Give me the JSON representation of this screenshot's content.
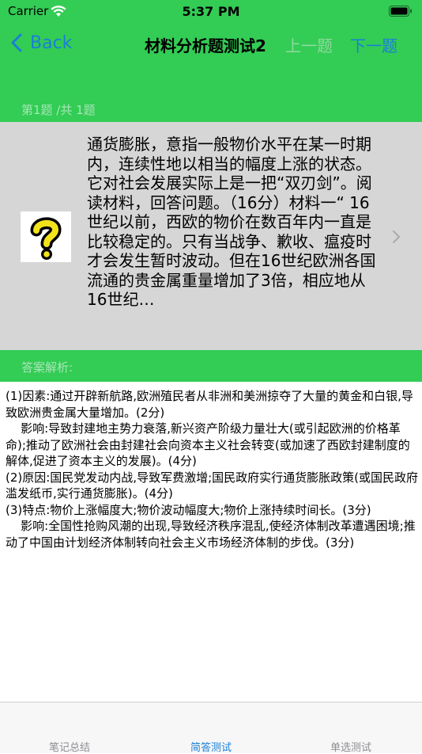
{
  "status": {
    "carrier": "Carrier",
    "time": "5:37 PM"
  },
  "nav": {
    "back_label": "Back",
    "title": "材料分析题测试2",
    "prev_label": "上一题",
    "next_label": "下一题"
  },
  "question_section": {
    "header": "第1题 /共 1题"
  },
  "question": {
    "text": "通货膨胀，意指一般物价水平在某一时期内，连续性地以相当的幅度上涨的状态。它对社会发展实际上是一把“双刃剑”。阅读材料，回答问题。（16分）材料一“ 16世纪以前，西欧的物价在数百年内一直是比较稳定的。只有当战争、歉收、瘟疫时才会发生暂时波动。但在16世纪欧洲各国流通的贵金属重量增加了3倍，相应地从16世纪…"
  },
  "answer_section": {
    "header": "答案解析:"
  },
  "answer": {
    "text": "(1)因素:通过开辟新航路,欧洲殖民者从非洲和美洲掠夺了大量的黄金和白银,导致欧洲贵金属大量增加。(2分)\n    影响:导致封建地主势力衰落,新兴资产阶级力量壮大(或引起欧洲的价格革命);推动了欧洲社会由封建社会向资本主义社会转变(或加速了西欧封建制度的解体,促进了资本主义的发展)。(4分)\n(2)原因:国民党发动内战,导致军费激增;国民政府实行通货膨胀政策(或国民政府滥发纸币,实行通货膨胀)。(4分)\n(3)特点:物价上涨幅度大;物价波动幅度大;物价上涨持续时间长。(3分)\n    影响:全国性抢购风潮的出现,导致经济秩序混乱,使经济体制改革遭遇困境;推动了中国由计划经济体制转向社会主义市场经济体制的步伐。(3分)"
  },
  "tabs": [
    {
      "label": "笔记总结"
    },
    {
      "label": "简答测试"
    },
    {
      "label": "单选测试"
    }
  ],
  "colors": {
    "green": "#33cc55",
    "accent": "#1a7fd6",
    "gray": "#d6d6d6"
  }
}
